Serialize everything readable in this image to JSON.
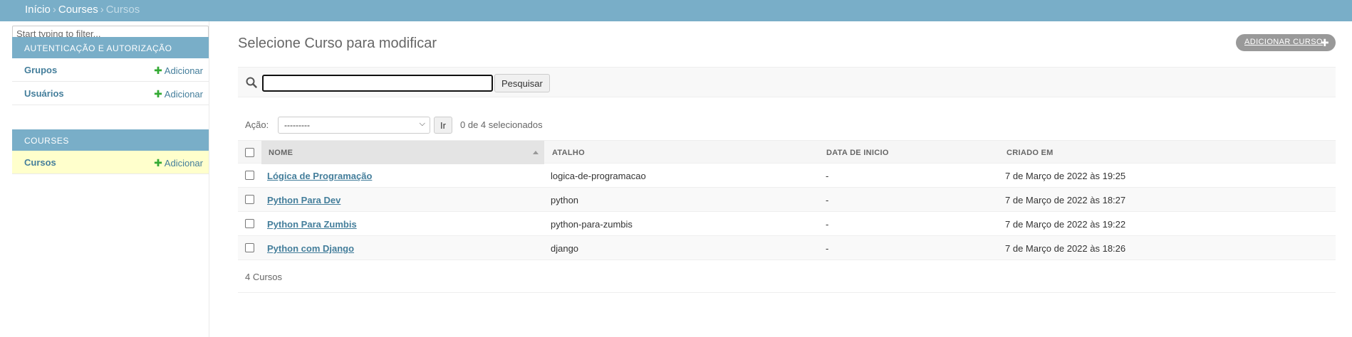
{
  "breadcrumbs": {
    "home": "Início",
    "sep": "›",
    "app": "Courses",
    "current": "Cursos"
  },
  "sidebar": {
    "filter_placeholder": "Start typing to filter...",
    "modules": [
      {
        "caption": "Autenticação e Autorização",
        "items": [
          {
            "name": "Grupos",
            "add": "Adicionar"
          },
          {
            "name": "Usuários",
            "add": "Adicionar"
          }
        ]
      },
      {
        "caption": "Courses",
        "items": [
          {
            "name": "Cursos",
            "add": "Adicionar"
          }
        ]
      }
    ]
  },
  "main": {
    "title": "Selecione Curso para modificar",
    "add_button": "Adicionar Curso",
    "search": {
      "value": "",
      "button": "Pesquisar"
    },
    "actions": {
      "label": "Ação:",
      "selected_option": "---------",
      "go": "Ir",
      "counter": "0 de 4 selecionados"
    },
    "table": {
      "headers": [
        "Nome",
        "Atalho",
        "Data de inicio",
        "Criado em"
      ],
      "rows": [
        {
          "nome": "Lógica de Programação",
          "atalho": "logica-de-programacao",
          "data_inicio": "-",
          "criado_em": "7 de Março de 2022 às 19:25"
        },
        {
          "nome": "Python Para Dev",
          "atalho": "python",
          "data_inicio": "-",
          "criado_em": "7 de Março de 2022 às 18:27"
        },
        {
          "nome": "Python Para Zumbis",
          "atalho": "python-para-zumbis",
          "data_inicio": "-",
          "criado_em": "7 de Março de 2022 às 19:22"
        },
        {
          "nome": "Python com Django",
          "atalho": "django",
          "data_inicio": "-",
          "criado_em": "7 de Março de 2022 às 18:26"
        }
      ]
    },
    "paginator": "4 Cursos"
  },
  "icons": {
    "search": "search-icon",
    "plus": "plus-icon",
    "sort": "sort-ascending-icon",
    "dropdown": "chevron-down-icon"
  },
  "colors": {
    "header_bar": "#79aec8",
    "link": "#447e9b",
    "add_green": "#33aa33",
    "active_row": "#ffffcc"
  }
}
